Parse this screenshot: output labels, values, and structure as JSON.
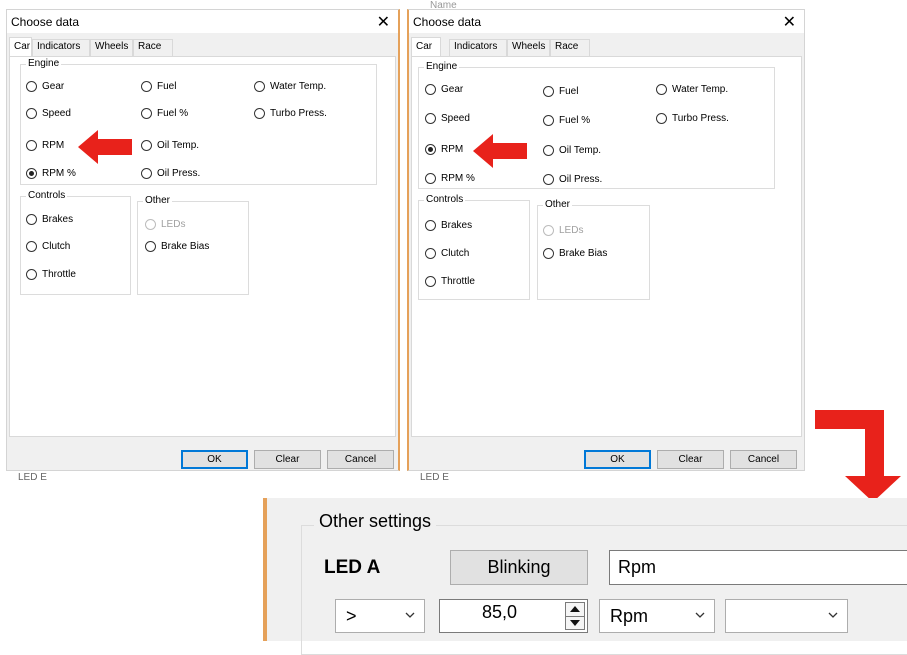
{
  "dialog": {
    "title": "Choose data",
    "close_glyph": "✕",
    "tabs": [
      "Car",
      "Indicators",
      "Wheels",
      "Race"
    ],
    "groups": {
      "engine": "Engine",
      "controls": "Controls",
      "other": "Other"
    },
    "engine": {
      "col1": [
        "Gear",
        "Speed",
        "RPM",
        "RPM %"
      ],
      "col2": [
        "Fuel",
        "Fuel %",
        "Oil Temp.",
        "Oil Press."
      ],
      "col3": [
        "Water Temp.",
        "Turbo Press."
      ]
    },
    "controls": [
      "Brakes",
      "Clutch",
      "Throttle"
    ],
    "other": [
      "LEDs",
      "Brake Bias"
    ],
    "buttons": {
      "ok": "OK",
      "clear": "Clear",
      "cancel": "Cancel"
    }
  },
  "dialog1": {
    "selected": "RPM %"
  },
  "dialog2": {
    "selected": "RPM"
  },
  "background_fragment": {
    "name": "Name",
    "led_e": "LED E"
  },
  "other_settings": {
    "title": "Other settings",
    "led_label": "LED A",
    "blinking_button": "Blinking",
    "field_value": "Rpm",
    "operator": ">",
    "threshold": "85,0",
    "unit": "Rpm",
    "extra": ""
  },
  "colors": {
    "arrow": "#e8221b",
    "accent_border": "#e5a15a",
    "default_button": "#0078d7"
  },
  "icons": {
    "close": "close-icon",
    "chevron": "chevron-down-icon",
    "spinner": "spinner-icon",
    "arrow": "red-arrow-icon"
  }
}
